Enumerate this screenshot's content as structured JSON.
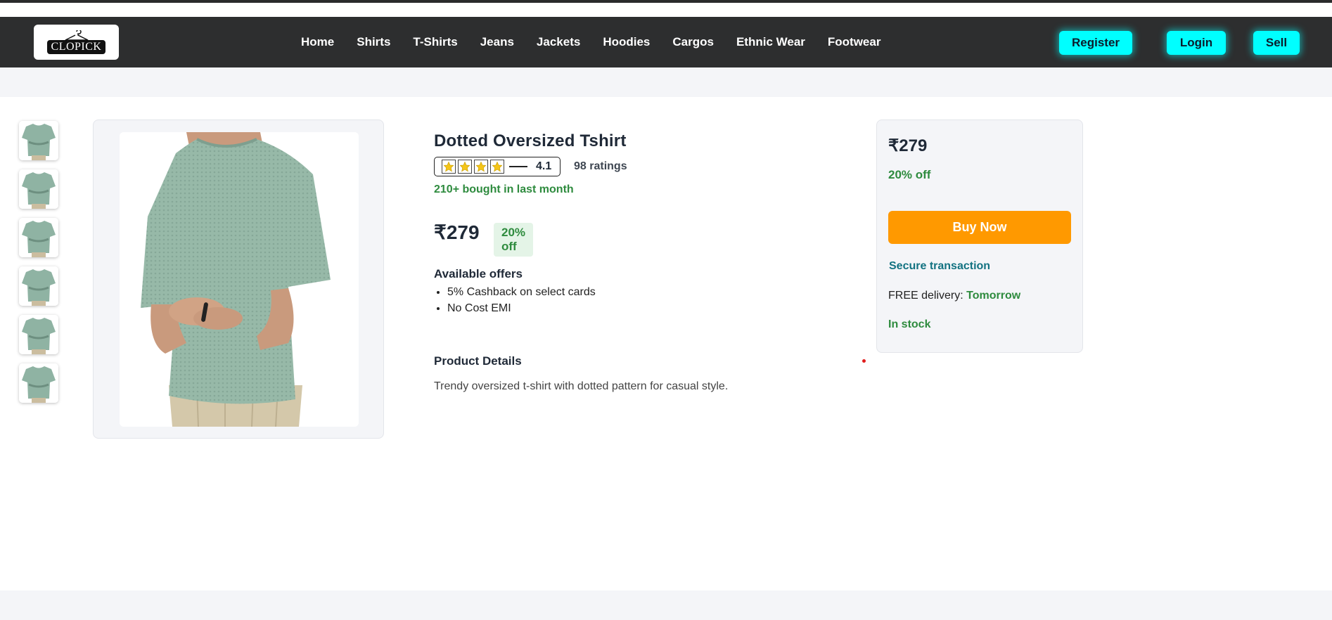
{
  "header": {
    "logo_text": "CLOPICK",
    "nav": [
      "Home",
      "Shirts",
      "T-Shirts",
      "Jeans",
      "Jackets",
      "Hoodies",
      "Cargos",
      "Ethnic Wear",
      "Footwear"
    ],
    "register_label": "Register",
    "login_label": "Login",
    "sell_label": "Sell",
    "accent_color": "#00ffff"
  },
  "gallery": {
    "thumbnail_count": 6
  },
  "product": {
    "title": "Dotted Oversized Tshirt",
    "rating": {
      "stars_filled": 4,
      "stars_total": 5,
      "value": "4.1",
      "count_text": "98 ratings"
    },
    "bought_text": "210+ bought in last month",
    "price": "₹279",
    "discount": "20% off",
    "offers_title": "Available offers",
    "offers": [
      "5% Cashback on select cards",
      "No Cost EMI"
    ],
    "details_title": "Product Details",
    "details_text": "Trendy oversized t-shirt with dotted pattern for casual style."
  },
  "buy_box": {
    "price": "₹279",
    "discount": "20% off",
    "buy_now_label": "Buy Now",
    "secure_text": "Secure transaction",
    "delivery_label": "FREE delivery:",
    "delivery_day": "Tomorrow",
    "stock_text": "In stock",
    "buy_color": "#ff9900",
    "success_color": "#2e8b3e"
  }
}
